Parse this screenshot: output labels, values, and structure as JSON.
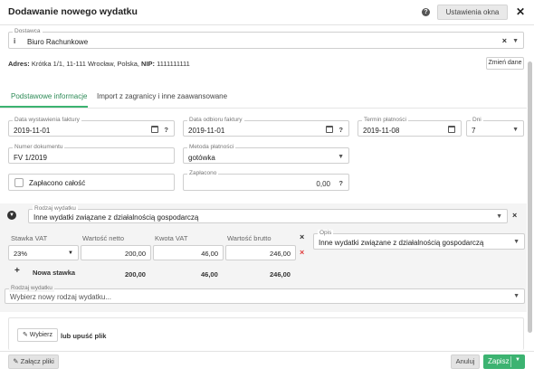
{
  "header": {
    "title": "Dodawanie nowego wydatku",
    "settings_label": "Ustawienia okna"
  },
  "supplier": {
    "label": "Dostawca",
    "value": "Biuro Rachunkowe",
    "address_label": "Adres:",
    "address": "Krótka 1/1, 11-111 Wrocław, Polska,",
    "nip_label": "NIP:",
    "nip": "1111111111",
    "change_label": "Zmień dane"
  },
  "tabs": [
    "Podstawowe informacje",
    "Import z zagranicy i inne zaawansowane"
  ],
  "form": {
    "issue_date": {
      "label": "Data wystawienia faktury",
      "value": "2019-11-01"
    },
    "receipt_date": {
      "label": "Data odbioru faktury",
      "value": "2019-11-01"
    },
    "due_date": {
      "label": "Termin płatności",
      "value": "2019-11-08"
    },
    "days": {
      "label": "Dni",
      "value": "7"
    },
    "doc_number": {
      "label": "Numer dokumentu",
      "value": "FV 1/2019"
    },
    "payment_method": {
      "label": "Metoda płatności",
      "value": "gotówka"
    },
    "paid_all_label": "Zapłacono całość",
    "paid": {
      "label": "Zapłacono",
      "value": "0,00"
    }
  },
  "expense": {
    "type_label": "Rodzaj wydatku",
    "type_value": "Inne wydatki związane z działalnością gospodarczą",
    "columns": [
      "Stawka VAT",
      "Wartość netto",
      "Kwota VAT",
      "Wartość brutto"
    ],
    "row": {
      "vat": "23%",
      "net": "200,00",
      "vat_amount": "46,00",
      "gross": "246,00"
    },
    "new_rate_label": "Nowa stawka",
    "totals": {
      "net": "200,00",
      "vat_amount": "46,00",
      "gross": "246,00"
    },
    "desc_label": "Opis",
    "desc_value": "Inne wydatki związane z działalnością gospodarczą"
  },
  "new_expense": {
    "label": "Rodzaj wydatku",
    "placeholder": "Wybierz nowy rodzaj wydatku..."
  },
  "upload": {
    "choose_label": "Wybierz",
    "drop_label": "lub upuść plik"
  },
  "footer": {
    "attach_label": "Załącz pliki",
    "cancel_label": "Anuluj",
    "save_label": "Zapisz"
  },
  "colors": {
    "accent": "#3cb371",
    "delete": "#e03c3c"
  }
}
